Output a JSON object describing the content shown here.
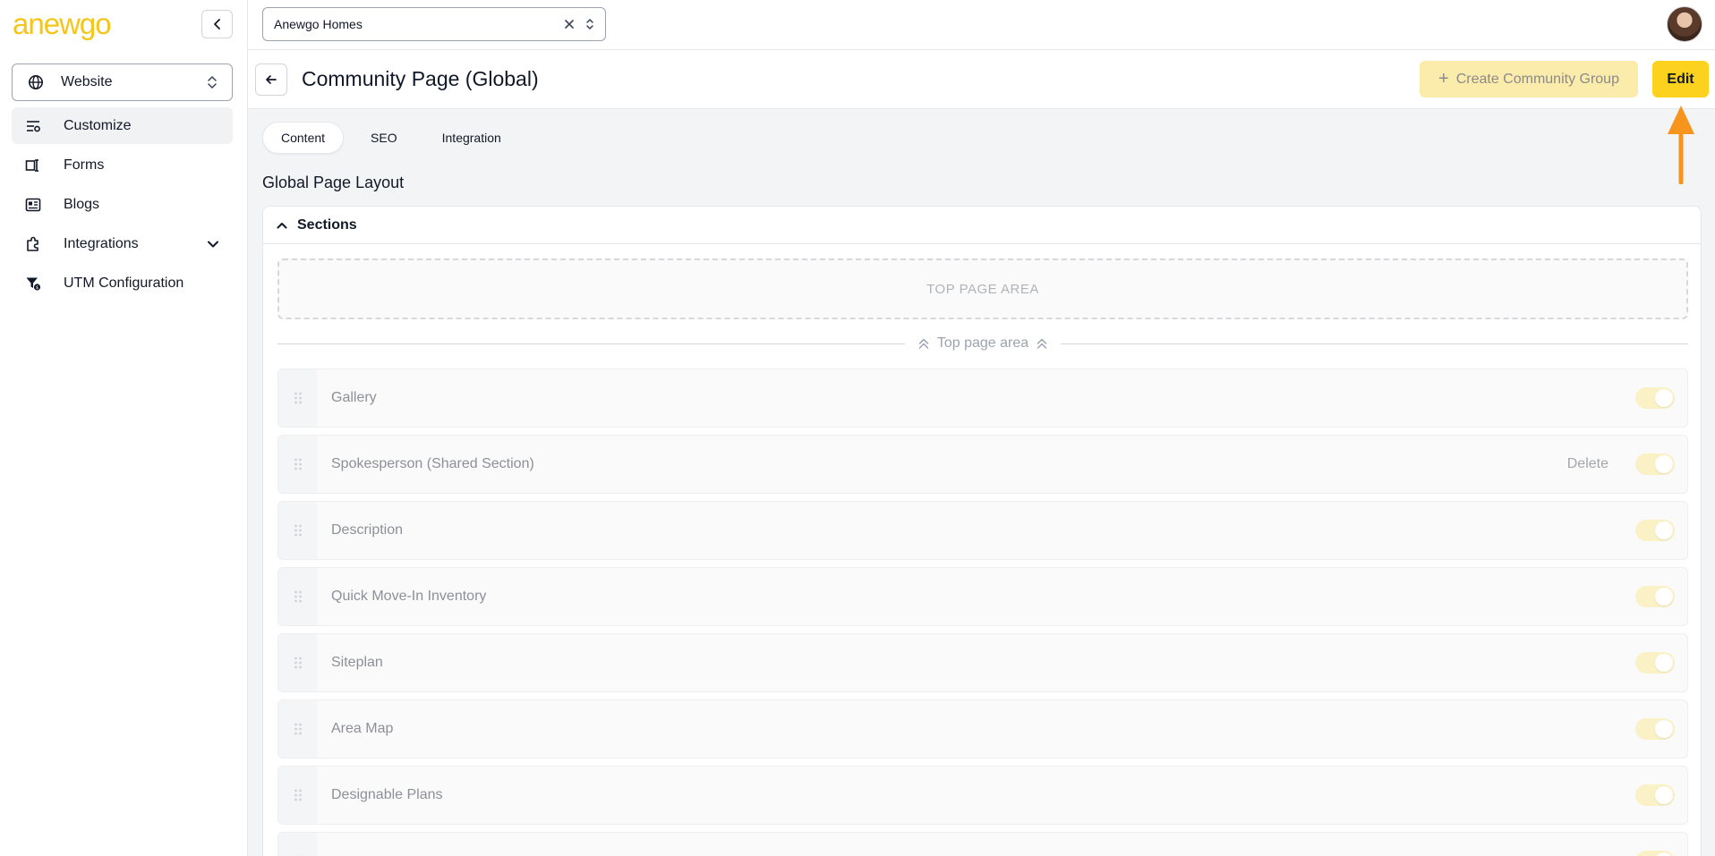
{
  "brand": {
    "logo_text_a": "a",
    "logo_text_b": "newgo",
    "accent_color": "#fcd21e"
  },
  "sidebar": {
    "site_select": {
      "label": "Website",
      "icon": "globe-icon"
    },
    "items": [
      {
        "label": "Customize",
        "icon": "sliders-icon",
        "active": true
      },
      {
        "label": "Forms",
        "icon": "form-icon"
      },
      {
        "label": "Blogs",
        "icon": "newspaper-icon"
      },
      {
        "label": "Integrations",
        "icon": "puzzle-icon",
        "has_chevron": true
      },
      {
        "label": "UTM Configuration",
        "icon": "funnel-icon"
      }
    ]
  },
  "topbar": {
    "builder_select": {
      "value": "Anewgo Homes"
    }
  },
  "header": {
    "title": "Community Page (Global)",
    "create_label": "Create Community Group",
    "edit_label": "Edit"
  },
  "tabs": [
    {
      "label": "Content",
      "active": true
    },
    {
      "label": "SEO"
    },
    {
      "label": "Integration"
    }
  ],
  "layout": {
    "title": "Global Page Layout",
    "sections_label": "Sections",
    "top_area_placeholder": "TOP PAGE AREA",
    "top_area_divider": "Top page area",
    "rows": [
      {
        "name": "Gallery",
        "enabled": true
      },
      {
        "name": "Spokesperson (Shared Section)",
        "enabled": true,
        "delete_label": "Delete"
      },
      {
        "name": "Description",
        "enabled": true
      },
      {
        "name": "Quick Move-In Inventory",
        "enabled": true
      },
      {
        "name": "Siteplan",
        "enabled": true
      },
      {
        "name": "Area Map",
        "enabled": true
      },
      {
        "name": "Designable Plans",
        "enabled": true
      }
    ]
  },
  "annotation": {
    "arrow_color": "#f7941d"
  }
}
